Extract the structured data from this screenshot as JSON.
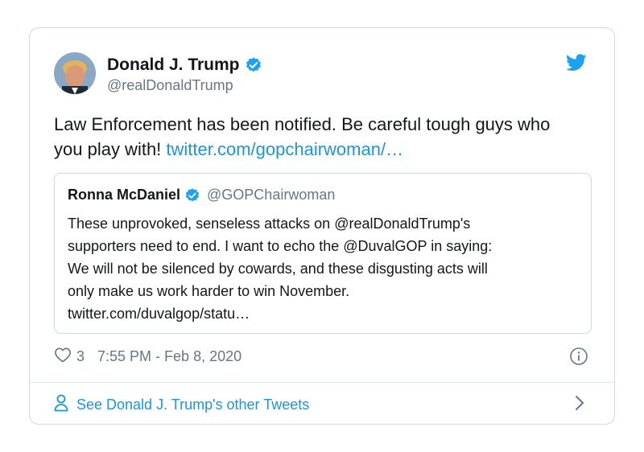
{
  "author": {
    "display_name": "Donald J. Trump",
    "handle": "@realDonaldTrump",
    "verified": true,
    "avatar_icon": "user-avatar"
  },
  "tweet": {
    "text_line1": "Law Enforcement has been notified. Be careful tough guys who",
    "text_line2_prefix": "you play with! ",
    "link_text": "twitter.com/gopchairwoman/…"
  },
  "quoted_tweet": {
    "display_name": "Ronna McDaniel",
    "handle": "@GOPChairwoman",
    "verified": true,
    "lines": [
      "These unprovoked, senseless attacks on @realDonaldTrump's",
      "supporters need to end. I want to echo the @DuvalGOP in saying:",
      "We will not be silenced by cowards, and these disgusting acts will",
      "only make us work harder to win November.",
      "twitter.com/duvalgop/statu…"
    ]
  },
  "meta": {
    "like_count": "3",
    "timestamp": "7:55 PM - Feb 8, 2020"
  },
  "footer": {
    "see_more_label": "See Donald J. Trump's other Tweets"
  },
  "colors": {
    "link": "#1b95e0",
    "verified": "#1da1f2",
    "muted": "#657786",
    "border": "#cfd9de"
  },
  "icons": [
    "verified-badge-icon",
    "twitter-bird-icon",
    "heart-icon",
    "info-icon",
    "person-icon",
    "chevron-right-icon"
  ]
}
